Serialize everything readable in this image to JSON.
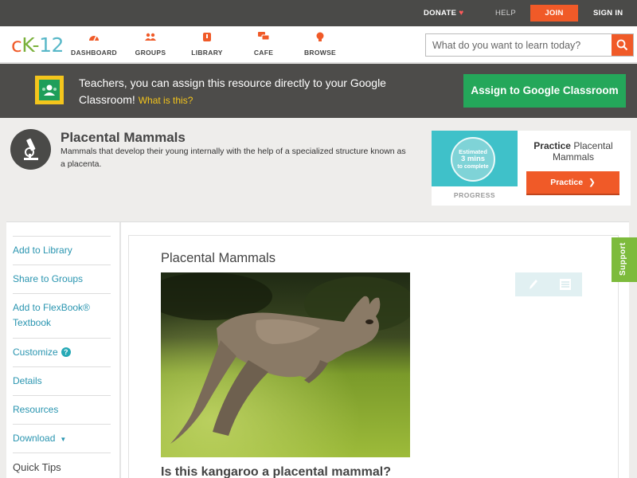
{
  "topbar": {
    "donate": "DONATE",
    "help": "HELP",
    "join": "JOIN",
    "signin": "SIGN IN"
  },
  "nav": {
    "logo": {
      "c": "c",
      "k": "K",
      "dash": "-",
      "num": "12"
    },
    "items": [
      {
        "label": "DASHBOARD",
        "icon": "dashboard-icon"
      },
      {
        "label": "GROUPS",
        "icon": "groups-icon"
      },
      {
        "label": "LIBRARY",
        "icon": "library-icon"
      },
      {
        "label": "CAFE",
        "icon": "cafe-icon"
      },
      {
        "label": "BROWSE",
        "icon": "browse-icon"
      }
    ],
    "search_placeholder": "What do you want to learn today?"
  },
  "banner": {
    "text": "Teachers, you can assign this resource directly to your Google Classroom!",
    "what": "What is this?",
    "button": "Assign to Google Classroom"
  },
  "header": {
    "title": "Placental Mammals",
    "description": "Mammals that develop their young internally with the help of a specialized structure known as a placenta."
  },
  "practice": {
    "estimated": "Estimated",
    "mins": "3 mins",
    "to_complete": "to complete",
    "progress": "PROGRESS",
    "title_bold": "Practice",
    "title_rest": "Placental Mammals",
    "button": "Practice"
  },
  "sidebar": {
    "items": [
      {
        "label": "Add to Library"
      },
      {
        "label": "Share to Groups"
      },
      {
        "label": "Add to FlexBook® Textbook"
      },
      {
        "label": "Customize"
      },
      {
        "label": "Details"
      },
      {
        "label": "Resources"
      },
      {
        "label": "Download"
      },
      {
        "label": "Quick Tips"
      }
    ]
  },
  "main": {
    "title": "Placental Mammals",
    "question": "Is this kangaroo a placental mammal?"
  },
  "support": "Support",
  "colors": {
    "accent": "#f05a28",
    "green": "#24a75a",
    "link": "#2a95b0",
    "support": "#7dbb3c"
  }
}
